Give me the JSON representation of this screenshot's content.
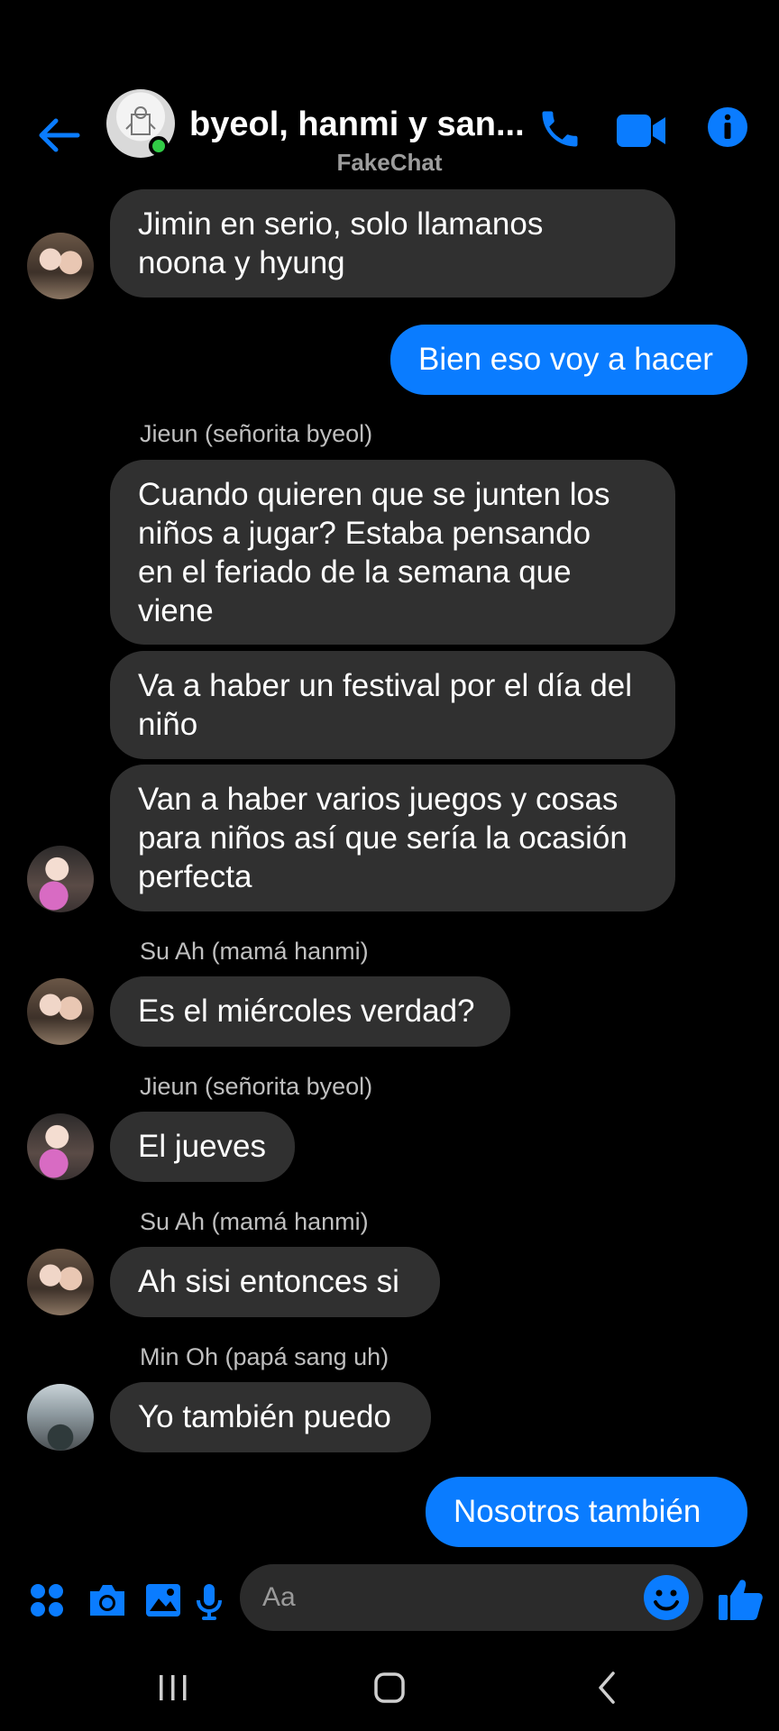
{
  "header": {
    "title": "byeol, hanmi y san...",
    "subtitle": "FakeChat"
  },
  "messages": [
    {
      "type": "incoming",
      "sender": "",
      "lines": [
        "Jimin en serio, solo llamanos",
        "noona y hyung"
      ]
    },
    {
      "type": "outgoing",
      "text": "Bien eso voy a hacer"
    },
    {
      "type": "incoming",
      "sender": "Jieun (señorita byeol)",
      "lines": [
        "Cuando quieren que se junten los",
        "niños a jugar? Estaba pensando",
        "en el feriado de la semana que",
        "viene"
      ]
    },
    {
      "type": "incoming",
      "sender": "",
      "lines": [
        "Va a haber un festival por el día del",
        "niño"
      ]
    },
    {
      "type": "incoming",
      "sender": "",
      "lines": [
        "Van a haber varios juegos y cosas",
        "para niños así que sería la ocasión",
        "perfecta"
      ]
    },
    {
      "type": "incoming",
      "sender": "Su Ah (mamá hanmi)",
      "lines": [
        "Es el miércoles verdad?"
      ]
    },
    {
      "type": "incoming",
      "sender": "Jieun (señorita byeol)",
      "lines": [
        "El jueves"
      ]
    },
    {
      "type": "incoming",
      "sender": "Su Ah (mamá hanmi)",
      "lines": [
        "Ah sisi entonces si"
      ]
    },
    {
      "type": "incoming",
      "sender": "Min Oh (papá sang uh)",
      "lines": [
        "Yo también puedo"
      ]
    },
    {
      "type": "outgoing",
      "text": "Nosotros también"
    }
  ],
  "composer": {
    "placeholder": "Aa"
  },
  "icons": {
    "back": "back-arrow-icon",
    "phone": "phone-icon",
    "video": "video-camera-icon",
    "info": "info-icon",
    "apps": "apps-grid-icon",
    "camera": "camera-icon",
    "gallery": "gallery-icon",
    "mic": "microphone-icon",
    "emoji": "emoji-icon",
    "like": "thumbs-up-icon"
  },
  "colors": {
    "accent": "#0a7cff",
    "bubble_incoming": "#303030",
    "online": "#31cc46"
  }
}
